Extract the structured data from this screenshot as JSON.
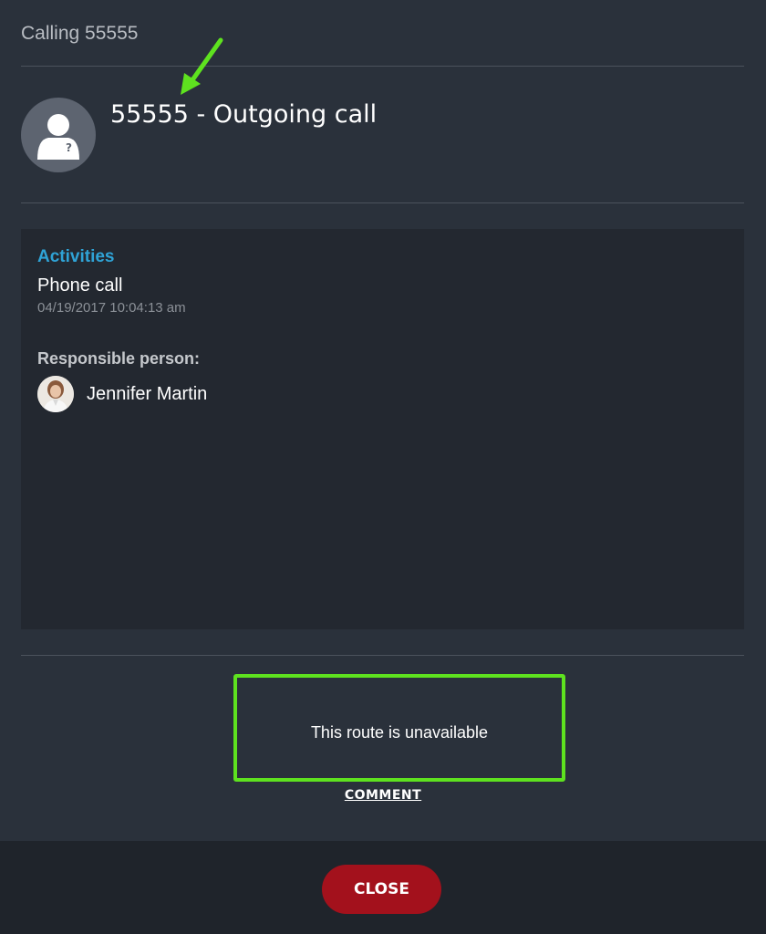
{
  "header": {
    "title": "Calling 55555"
  },
  "caller": {
    "title": "55555 - Outgoing call",
    "avatar_icon": "unknown-person-icon"
  },
  "activities": {
    "section_label": "Activities",
    "name": "Phone call",
    "timestamp": "04/19/2017 10:04:13 am",
    "responsible_label": "Responsible person:",
    "responsible_name": "Jennifer Martin"
  },
  "route": {
    "status_text": "This route is unavailable"
  },
  "comment": {
    "label": "COMMENT"
  },
  "footer": {
    "close_label": "CLOSE"
  },
  "colors": {
    "accent_blue": "#2fa3d6",
    "close_red": "#a3111c",
    "annotation_green": "#5ee21f",
    "background": "#2a313b"
  }
}
